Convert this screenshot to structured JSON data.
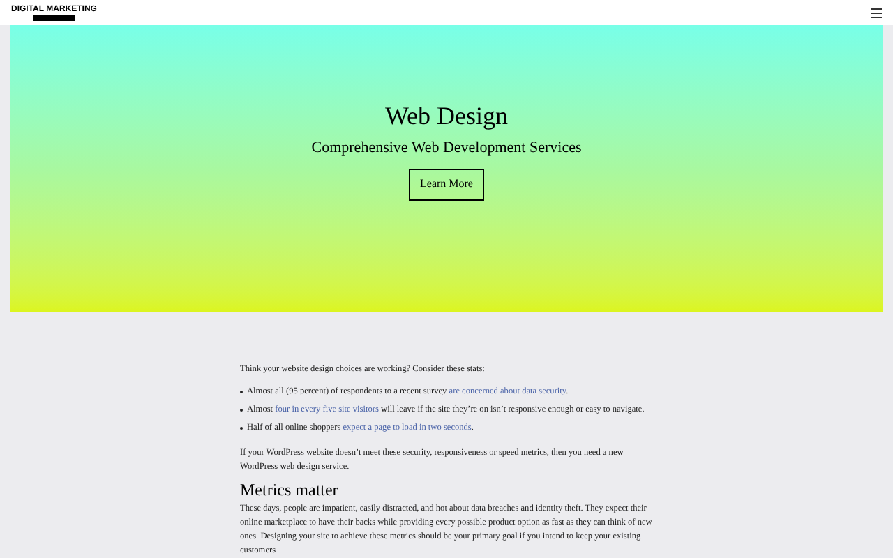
{
  "header": {
    "logo_text": "DIGITAL MARKETING"
  },
  "hero": {
    "title": "Web Design",
    "subtitle": "Comprehensive Web Development Services",
    "button": "Learn More"
  },
  "content": {
    "intro": "Think your website design choices are working? Consider these stats:",
    "bullets": [
      {
        "before": "Almost all (95 percent) of respondents to a recent survey ",
        "link": "are concerned about data security",
        "after": "."
      },
      {
        "before": "Almost ",
        "link": "four in every five site visitors",
        "after": " will leave if the site they’re on isn’t responsive enough or easy to navigate."
      },
      {
        "before": "Half of all online shoppers ",
        "link": "expect a page to load in two seconds",
        "after": "."
      }
    ],
    "paragraph": "If your WordPress website doesn’t meet these security, responsiveness or speed metrics, then you need a new WordPress web design service.",
    "heading": "Metrics matter",
    "paragraph_2": "These days, people are impatient, easily distracted, and hot about data breaches and identity theft. They expect their online marketplace to have their backs while providing every possible product option as fast as they can think of new ones. Designing your site to achieve these metrics should be your primary goal if you intend to keep your existing customers"
  }
}
